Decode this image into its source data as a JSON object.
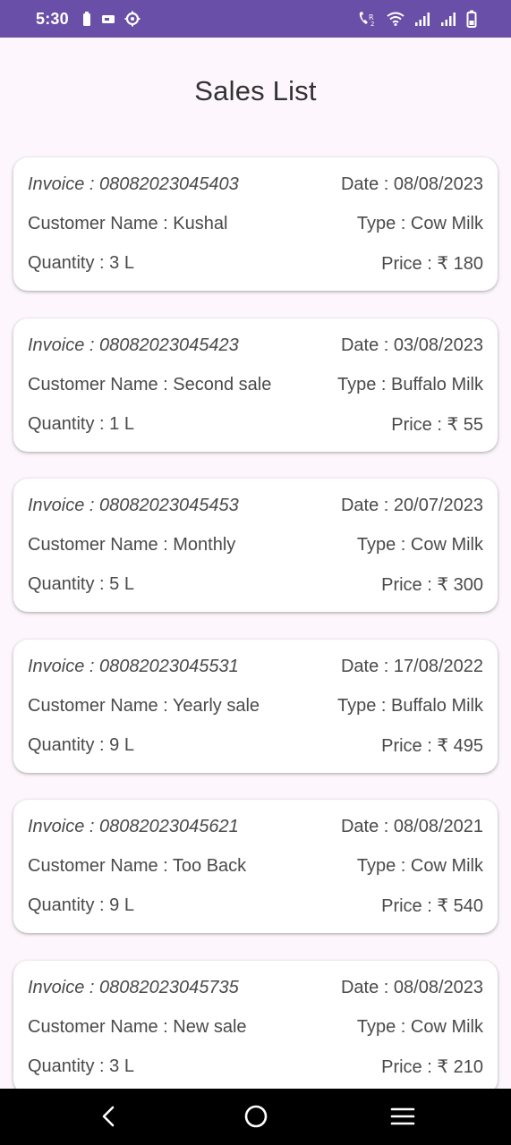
{
  "status_bar": {
    "time": "5:30",
    "left_icons": [
      "battery-saver-icon",
      "cast-icon",
      "settings-icon"
    ],
    "right_icons": [
      "volte-wifi-call-icon",
      "wifi-icon",
      "signal-1-icon",
      "signal-2-icon",
      "battery-icon"
    ]
  },
  "header": {
    "title": "Sales List"
  },
  "sales": [
    {
      "invoice": "Invoice : 08082023045403",
      "date": "Date : 08/08/2023",
      "customer": "Customer Name : Kushal",
      "type": "Type : Cow Milk",
      "quantity": "Quantity : 3 L",
      "price": "Price : ₹ 180"
    },
    {
      "invoice": "Invoice : 08082023045423",
      "date": "Date : 03/08/2023",
      "customer": "Customer Name : Second sale",
      "type": "Type : Buffalo Milk",
      "quantity": "Quantity : 1 L",
      "price": "Price : ₹ 55"
    },
    {
      "invoice": "Invoice : 08082023045453",
      "date": "Date : 20/07/2023",
      "customer": "Customer Name : Monthly",
      "type": "Type : Cow Milk",
      "quantity": "Quantity : 5 L",
      "price": "Price : ₹ 300"
    },
    {
      "invoice": "Invoice : 08082023045531",
      "date": "Date : 17/08/2022",
      "customer": "Customer Name : Yearly sale",
      "type": "Type : Buffalo Milk",
      "quantity": "Quantity : 9 L",
      "price": "Price : ₹ 495"
    },
    {
      "invoice": "Invoice : 08082023045621",
      "date": "Date : 08/08/2021",
      "customer": "Customer Name : Too Back",
      "type": "Type : Cow Milk",
      "quantity": "Quantity : 9 L",
      "price": "Price : ₹ 540"
    },
    {
      "invoice": "Invoice : 08082023045735",
      "date": "Date : 08/08/2023",
      "customer": "Customer Name : New sale",
      "type": "Type : Cow Milk",
      "quantity": "Quantity : 3 L",
      "price": "Price : ₹ 210"
    }
  ],
  "nav_bar": {
    "buttons": [
      "back-icon",
      "home-icon",
      "recents-menu-icon"
    ]
  },
  "colors": {
    "status_bar": "#6a4fa8",
    "background": "#fdf7fd",
    "card": "#ffffff",
    "nav_bar": "#000000"
  }
}
